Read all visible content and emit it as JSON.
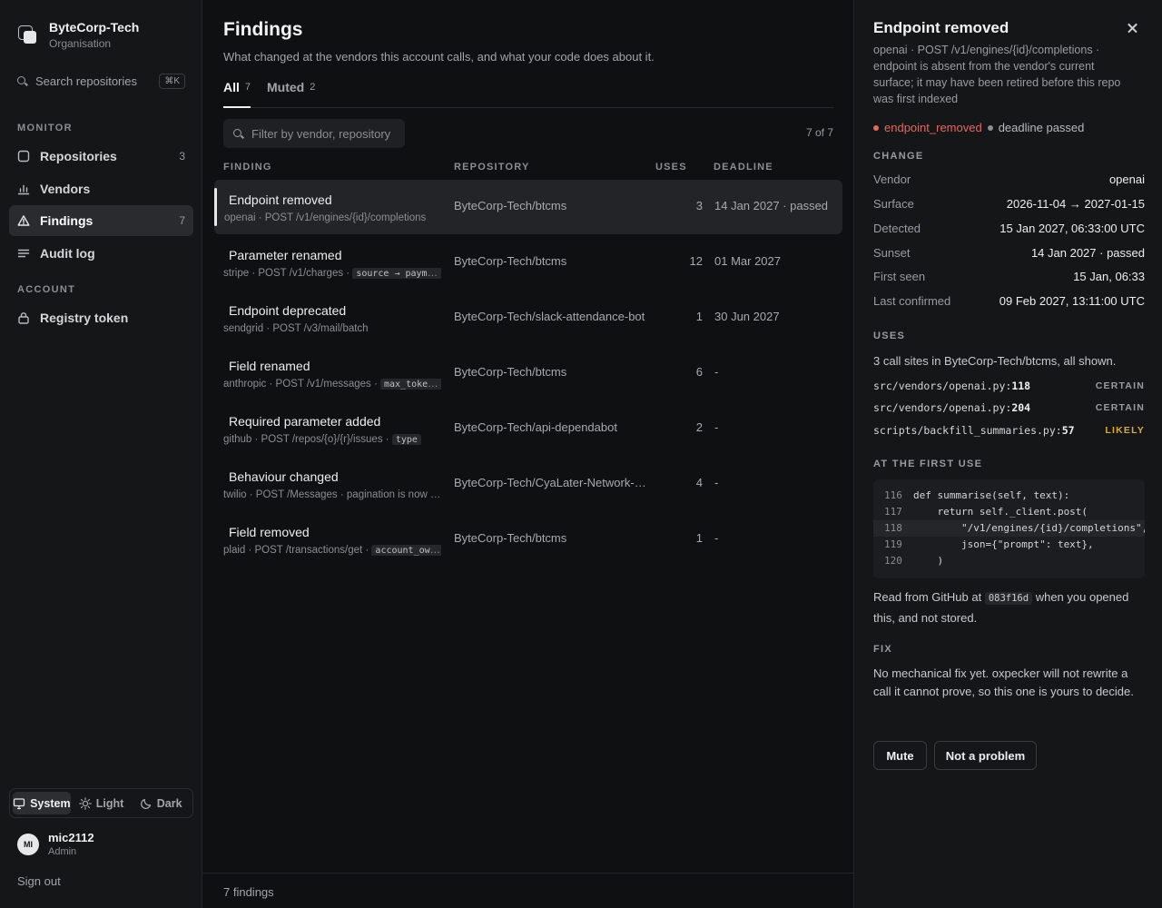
{
  "org": {
    "name": "ByteCorp-Tech",
    "subtitle": "Organisation"
  },
  "search": {
    "placeholder": "Search repositories",
    "shortcut": "⌘K"
  },
  "sidebar": {
    "monitor_label": "MONITOR",
    "account_label": "ACCOUNT",
    "items": [
      {
        "label": "Repositories",
        "count": "3"
      },
      {
        "label": "Vendors",
        "count": ""
      },
      {
        "label": "Findings",
        "count": "7"
      },
      {
        "label": "Audit log",
        "count": ""
      },
      {
        "label": "Registry token",
        "count": ""
      }
    ]
  },
  "theme": {
    "options": [
      "System",
      "Light",
      "Dark"
    ],
    "selected": "System"
  },
  "user": {
    "initials": "MI",
    "name": "mic2112",
    "role": "Admin",
    "sign_out": "Sign out"
  },
  "main": {
    "title": "Findings",
    "subtitle": "What changed at the vendors this account calls, and what your code does about it.",
    "tabs": [
      {
        "label": "All",
        "count": "7"
      },
      {
        "label": "Muted",
        "count": "2"
      }
    ],
    "filter_placeholder": "Filter by vendor, repository",
    "count_text": "7 of 7",
    "columns": [
      "FINDING",
      "REPOSITORY",
      "USES",
      "DEADLINE"
    ],
    "rows": [
      {
        "title": "Endpoint removed",
        "sub": "openai · POST /v1/engines/{id}/completions",
        "code": "",
        "repo": "ByteCorp-Tech/btcms",
        "uses": "3",
        "deadline": "14 Jan 2027 · passed"
      },
      {
        "title": "Parameter renamed",
        "sub": "stripe · POST /v1/charges · ",
        "code": "source → payment_method",
        "repo": "ByteCorp-Tech/btcms",
        "uses": "12",
        "deadline": "01 Mar 2027"
      },
      {
        "title": "Endpoint deprecated",
        "sub": "sendgrid · POST /v3/mail/batch",
        "code": "",
        "repo": "ByteCorp-Tech/slack-attendance-bot",
        "uses": "1",
        "deadline": "30 Jun 2027"
      },
      {
        "title": "Field renamed",
        "sub": "anthropic · POST /v1/messages · ",
        "code": "max_tokens_to_sample",
        "repo": "ByteCorp-Tech/btcms",
        "uses": "6",
        "deadline": "-"
      },
      {
        "title": "Required parameter added",
        "sub": "github · POST /repos/{o}/{r}/issues · ",
        "code": "type",
        "repo": "ByteCorp-Tech/api-dependabot",
        "uses": "2",
        "deadline": "-"
      },
      {
        "title": "Behaviour changed",
        "sub": "twilio · POST /Messages · pagination is now cursor based",
        "code": "",
        "repo": "ByteCorp-Tech/CyaLater-Network-service",
        "uses": "4",
        "deadline": "-"
      },
      {
        "title": "Field removed",
        "sub": "plaid · POST /transactions/get · ",
        "code": "account_owner",
        "repo": "ByteCorp-Tech/btcms",
        "uses": "1",
        "deadline": "-"
      }
    ],
    "footer": "7 findings"
  },
  "panel": {
    "title": "Endpoint removed",
    "description": "openai · POST /v1/engines/{id}/completions · endpoint is absent from the vendor's current surface; it may have been retired before this repo was first indexed",
    "badge_status": "endpoint_removed",
    "badge_deadline": "deadline passed",
    "change_label": "CHANGE",
    "change": [
      {
        "k": "Vendor",
        "v": "openai"
      },
      {
        "k": "Surface",
        "v": "2026-11-04 → 2027-01-15"
      },
      {
        "k": "Detected",
        "v": "15 Jan 2027, 06:33:00 UTC"
      },
      {
        "k": "Sunset",
        "v": "14 Jan 2027 · passed"
      },
      {
        "k": "First seen",
        "v": "15 Jan, 06:33"
      },
      {
        "k": "Last confirmed",
        "v": "09 Feb 2027, 13:11:00 UTC"
      }
    ],
    "uses_label": "USES",
    "uses_text": "3 call sites in ByteCorp-Tech/btcms, all shown.",
    "callsites": [
      {
        "path": "src/vendors/openai.py:",
        "line": "118",
        "cert": "CERTAIN"
      },
      {
        "path": "src/vendors/openai.py:",
        "line": "204",
        "cert": "CERTAIN"
      },
      {
        "path": "scripts/backfill_summaries.py:",
        "line": "57",
        "cert": "LIKELY"
      }
    ],
    "first_use_label": "AT THE FIRST USE",
    "code": [
      {
        "n": "116",
        "t": "def summarise(self, text):"
      },
      {
        "n": "117",
        "t": "    return self._client.post("
      },
      {
        "n": "118",
        "t": "        \"/v1/engines/{id}/completions\","
      },
      {
        "n": "119",
        "t": "        json={\"prompt\": text},"
      },
      {
        "n": "120",
        "t": "    )"
      }
    ],
    "note_pre": "Read from GitHub at ",
    "note_sha": "083f16d",
    "note_post": " when you opened this, and not stored.",
    "fix_label": "FIX",
    "fix_text": "No mechanical fix yet. oxpecker will not rewrite a call it cannot prove, so this one is yours to decide.",
    "mute_label": "Mute",
    "not_problem_label": "Not a problem"
  }
}
